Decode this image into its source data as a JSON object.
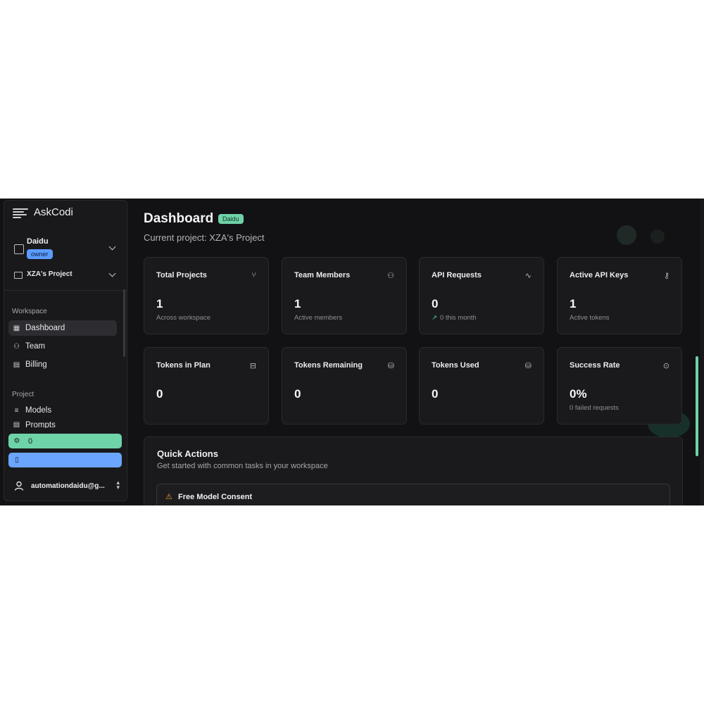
{
  "brand": {
    "name": "AskCodi"
  },
  "workspace": {
    "name": "Daidu",
    "role": "owner"
  },
  "project": {
    "name": "XZA's Project"
  },
  "sidebar": {
    "sections": [
      {
        "title": "Workspace",
        "items": [
          "Dashboard",
          "Team",
          "Billing"
        ]
      },
      {
        "title": "Project",
        "items": [
          "Models",
          "Prompts"
        ]
      }
    ],
    "active_item": "Dashboard",
    "credits_value": "0",
    "user_email": "automationdaidu@g..."
  },
  "header": {
    "title": "Dashboard",
    "badge": "Daidu",
    "subtitle": "Current project: XZA's Project"
  },
  "stats": [
    {
      "title": "Total Projects",
      "icon": "git-branch-icon",
      "value": "1",
      "sub": "Across workspace"
    },
    {
      "title": "Team Members",
      "icon": "users-icon",
      "value": "1",
      "sub": "Active members"
    },
    {
      "title": "API Requests",
      "icon": "activity-icon",
      "value": "0",
      "sub": "0 this month",
      "trend": "up"
    },
    {
      "title": "Active API Keys",
      "icon": "key-icon",
      "value": "1",
      "sub": "Active tokens"
    },
    {
      "title": "Tokens in Plan",
      "icon": "bot-icon",
      "value": "0",
      "sub": ""
    },
    {
      "title": "Tokens Remaining",
      "icon": "database-icon",
      "value": "0",
      "sub": ""
    },
    {
      "title": "Tokens Used",
      "icon": "database-icon",
      "value": "0",
      "sub": ""
    },
    {
      "title": "Success Rate",
      "icon": "check-circle-icon",
      "value": "0%",
      "sub": "0 failed requests"
    }
  ],
  "quick_actions": {
    "title": "Quick Actions",
    "subtitle": "Get started with common tasks in your workspace",
    "items": [
      {
        "label": "Free Model Consent",
        "icon": "warning-icon"
      }
    ]
  },
  "colors": {
    "accent_green": "#6fd3a8",
    "accent_blue": "#6aa6ff",
    "background": "#121214",
    "card": "#1a1a1d"
  }
}
